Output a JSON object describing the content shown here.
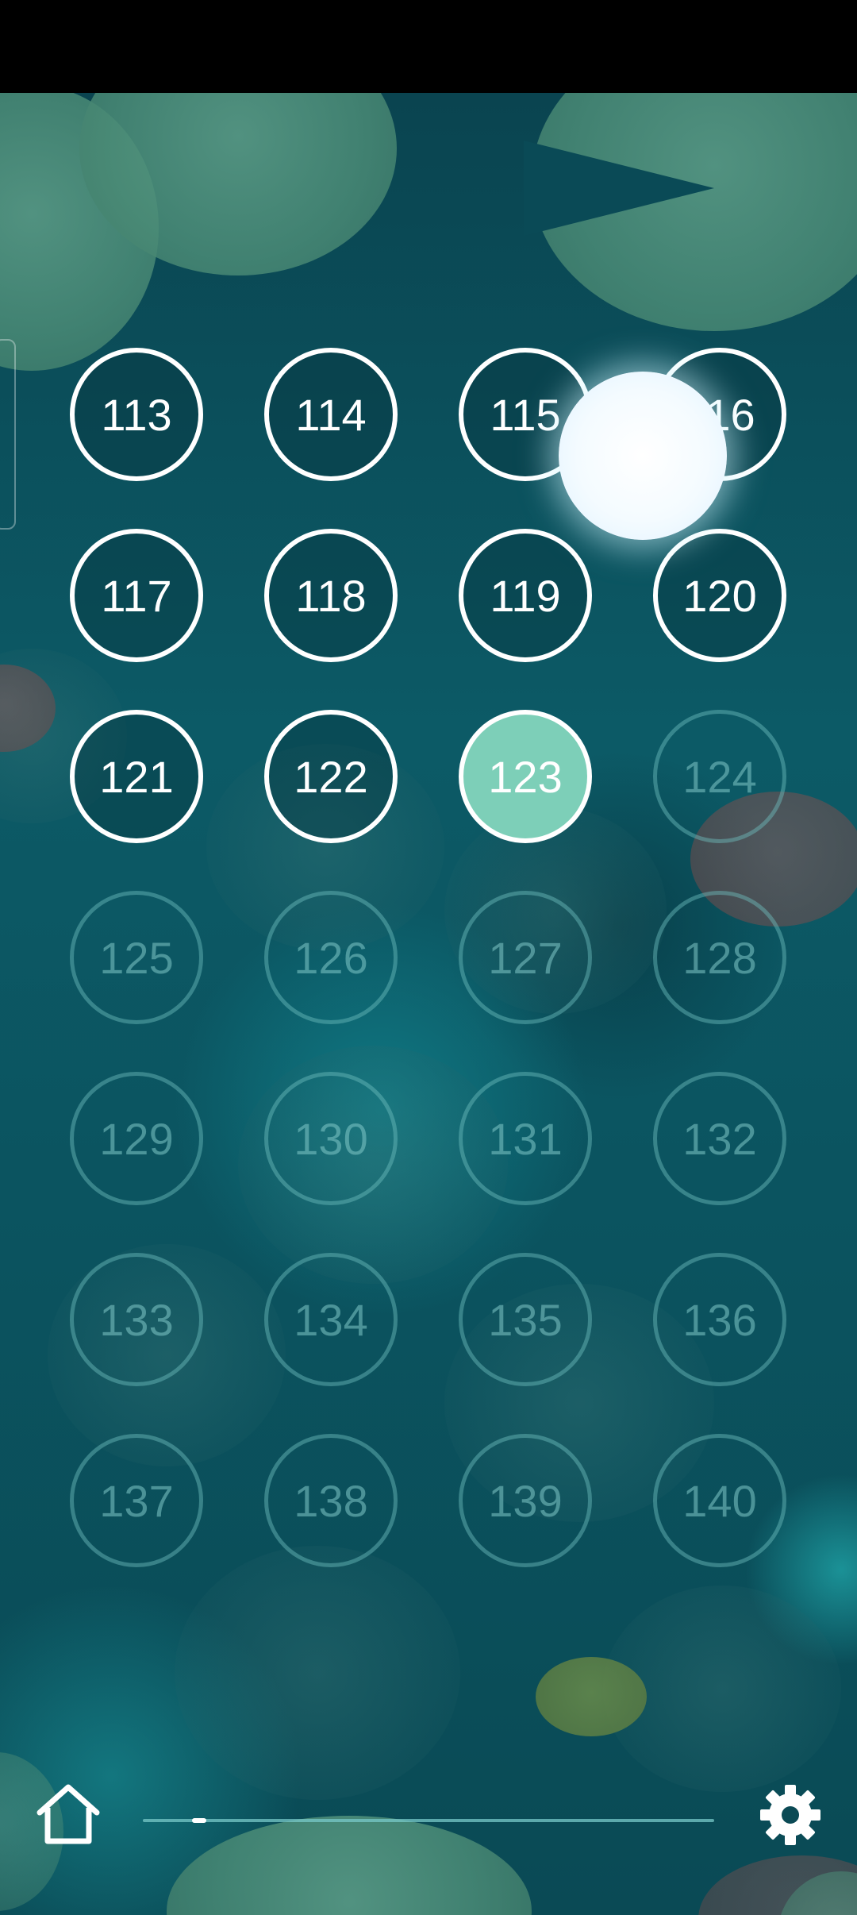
{
  "levels": [
    {
      "label": "113",
      "state": "unlocked"
    },
    {
      "label": "114",
      "state": "unlocked"
    },
    {
      "label": "115",
      "state": "unlocked"
    },
    {
      "label": "116",
      "state": "unlocked"
    },
    {
      "label": "117",
      "state": "unlocked"
    },
    {
      "label": "118",
      "state": "unlocked"
    },
    {
      "label": "119",
      "state": "unlocked"
    },
    {
      "label": "120",
      "state": "unlocked"
    },
    {
      "label": "121",
      "state": "unlocked"
    },
    {
      "label": "122",
      "state": "unlocked"
    },
    {
      "label": "123",
      "state": "current"
    },
    {
      "label": "124",
      "state": "locked"
    },
    {
      "label": "125",
      "state": "locked"
    },
    {
      "label": "126",
      "state": "locked"
    },
    {
      "label": "127",
      "state": "locked"
    },
    {
      "label": "128",
      "state": "locked"
    },
    {
      "label": "129",
      "state": "locked"
    },
    {
      "label": "130",
      "state": "locked"
    },
    {
      "label": "131",
      "state": "locked"
    },
    {
      "label": "132",
      "state": "locked"
    },
    {
      "label": "133",
      "state": "locked"
    },
    {
      "label": "134",
      "state": "locked"
    },
    {
      "label": "135",
      "state": "locked"
    },
    {
      "label": "136",
      "state": "locked"
    },
    {
      "label": "137",
      "state": "locked"
    },
    {
      "label": "138",
      "state": "locked"
    },
    {
      "label": "139",
      "state": "locked"
    },
    {
      "label": "140",
      "state": "locked"
    }
  ],
  "footer": {
    "home_icon": "home-icon",
    "settings_icon": "gear-icon",
    "page_progress_fraction": 0.1
  },
  "colors": {
    "current_level_fill": "#7dcfb8",
    "unlocked_ring": "#ffffff",
    "locked_ring": "#6ebebe",
    "pond_background": "#0b5460"
  }
}
